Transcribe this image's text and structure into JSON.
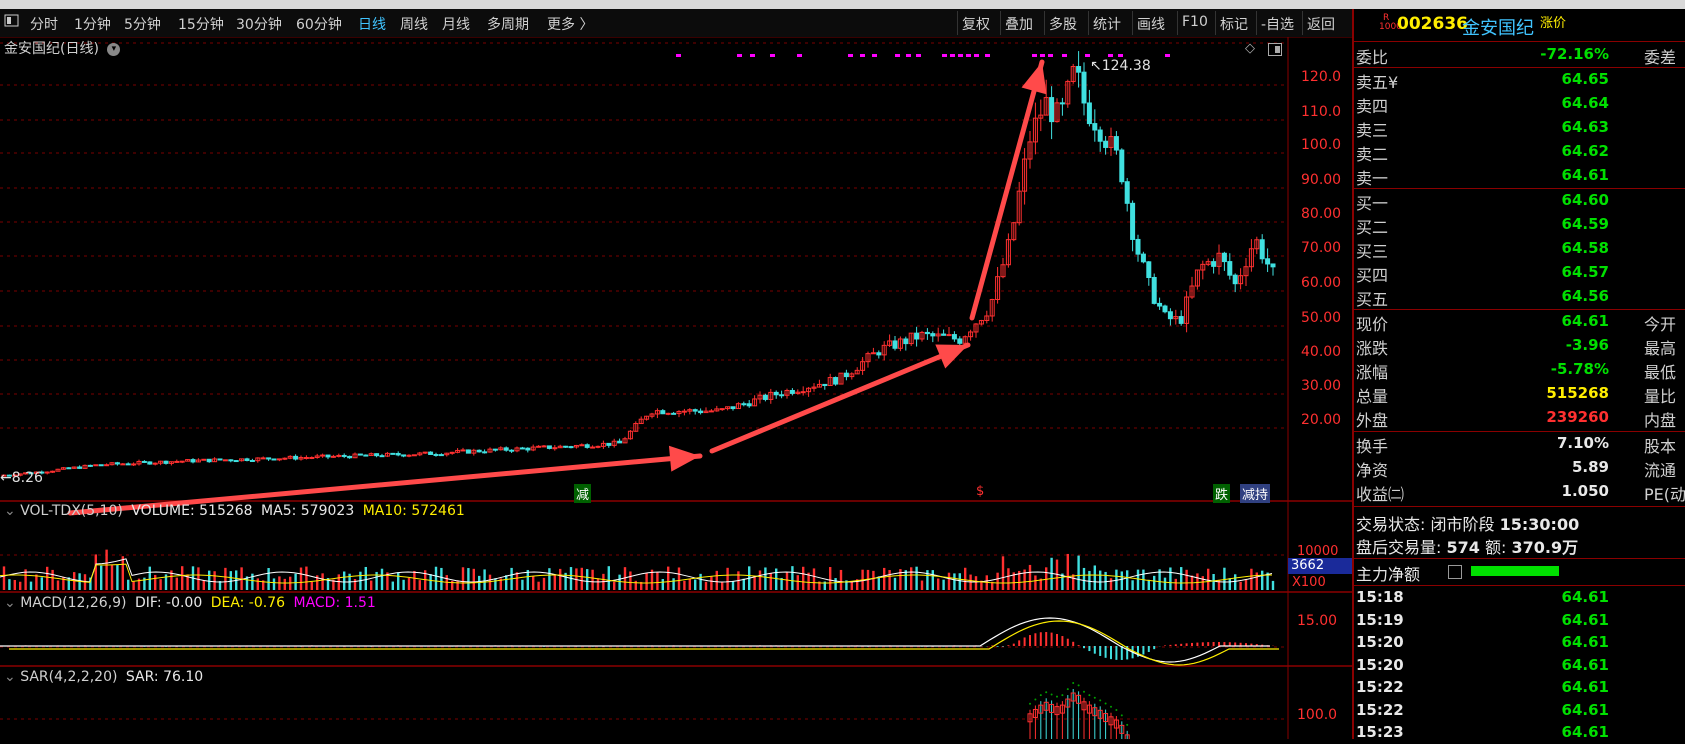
{
  "toolbar": {
    "left_items": [
      "分时",
      "1分钟",
      "5分钟",
      "15分钟",
      "30分钟",
      "60分钟",
      "日线",
      "周线",
      "月线",
      "多周期",
      "更多 〉"
    ],
    "active": "日线",
    "right_items": [
      "复权",
      "叠加",
      "多股",
      "统计",
      "画线",
      "F10",
      "标记",
      "-自选",
      "返回"
    ]
  },
  "chart": {
    "title": "金安国纪(日线)",
    "price_axis": [
      "120.0",
      "110.0",
      "100.0",
      "90.00",
      "80.00",
      "70.00",
      "60.00",
      "50.00",
      "40.00",
      "30.00",
      "20.00"
    ],
    "high_marker": "124.38",
    "low_marker": "8.26",
    "event_labels": [
      "减",
      "$",
      "跌",
      "减持"
    ],
    "volume_panel": {
      "title": "VOL-TDX(5,10)",
      "volume": "VOLUME: 515268",
      "ma5": "MA5: 579023",
      "ma10": "MA10: 572461",
      "axis_top": "10000",
      "axis_value": "3662",
      "axis_unit": "X100"
    },
    "macd_panel": {
      "title": "MACD(12,26,9)",
      "dif": "DIF: -0.00",
      "dea": "DEA: -0.76",
      "macd": "MACD: 1.51",
      "axis": "15.00"
    },
    "sar_panel": {
      "title": "SAR(4,2,2,20)",
      "sar": "SAR: 76.10",
      "axis": "100.0"
    }
  },
  "quote": {
    "badge_top": "R",
    "badge_bottom": "1000",
    "code": "002636",
    "name": "金安国纪",
    "tag": "涨价",
    "weibi_label": "委比",
    "weibi_value": "-72.16%",
    "weicha_label": "委差",
    "sell": [
      {
        "label": "卖五¥",
        "price": "64.65"
      },
      {
        "label": "卖四",
        "price": "64.64"
      },
      {
        "label": "卖三",
        "price": "64.63"
      },
      {
        "label": "卖二",
        "price": "64.62"
      },
      {
        "label": "卖一",
        "price": "64.61"
      }
    ],
    "buy": [
      {
        "label": "买一",
        "price": "64.60"
      },
      {
        "label": "买二",
        "price": "64.59"
      },
      {
        "label": "买三",
        "price": "64.58"
      },
      {
        "label": "买四",
        "price": "64.57"
      },
      {
        "label": "买五",
        "price": "64.56"
      }
    ],
    "stats": [
      {
        "label": "现价",
        "value": "64.61",
        "right": "今开",
        "color": "green"
      },
      {
        "label": "涨跌",
        "value": "-3.96",
        "right": "最高",
        "color": "green"
      },
      {
        "label": "涨幅",
        "value": "-5.78%",
        "right": "最低",
        "color": "green"
      },
      {
        "label": "总量",
        "value": "515268",
        "right": "量比",
        "color": "yellow"
      },
      {
        "label": "外盘",
        "value": "239260",
        "right": "内盘",
        "color": "red"
      }
    ],
    "stats2": [
      {
        "label": "换手",
        "value": "7.10%",
        "right": "股本",
        "color": "white"
      },
      {
        "label": "净资",
        "value": "5.89",
        "right": "流通",
        "color": "white"
      },
      {
        "label": "收益㈡",
        "value": "1.050",
        "right": "PE(动",
        "color": "white"
      }
    ],
    "trade_status_label": "交易状态:",
    "trade_status": "闭市阶段",
    "trade_time": "15:30:00",
    "after_hours_label": "盘后交易量:",
    "after_hours_vol": "574",
    "after_hours_amt_label": "额:",
    "after_hours_amt": "370.9万",
    "main_flow_label": "主力净额"
  },
  "ticks": [
    {
      "time": "15:18",
      "price": "64.61"
    },
    {
      "time": "15:19",
      "price": "64.61"
    },
    {
      "time": "15:20",
      "price": "64.61"
    },
    {
      "time": "15:20",
      "price": "64.61"
    },
    {
      "time": "15:22",
      "price": "64.61"
    },
    {
      "time": "15:22",
      "price": "64.61"
    },
    {
      "time": "15:23",
      "price": "64.61"
    }
  ],
  "colors": {
    "up": "#ff3030",
    "down": "#40e0e0",
    "arrow": "#ff4a4a",
    "grid": "#7a0000",
    "ma5": "#ffffff",
    "ma10": "#ffee00",
    "macd": "#ff00ff"
  }
}
